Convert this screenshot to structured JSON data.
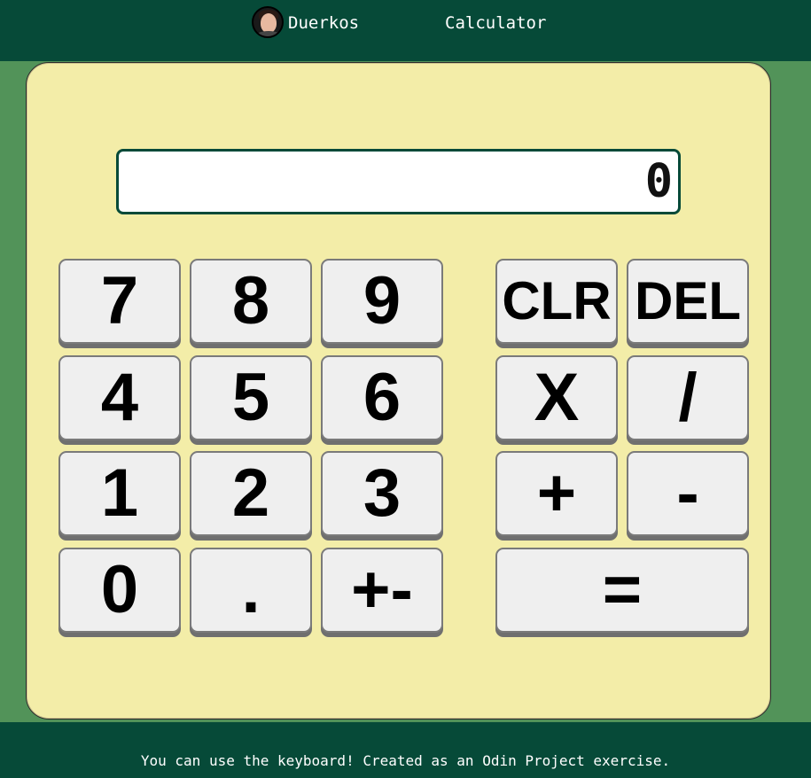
{
  "header": {
    "author_name": "Duerkos",
    "title": "Calculator"
  },
  "display": {
    "value": "0"
  },
  "keys": {
    "k7": "7",
    "k8": "8",
    "k9": "9",
    "k4": "4",
    "k5": "5",
    "k6": "6",
    "k1": "1",
    "k2": "2",
    "k3": "3",
    "k0": "0",
    "decimal": ".",
    "sign": "+-",
    "clear": "CLR",
    "delete": "DEL",
    "multiply": "X",
    "divide": "/",
    "add": "+",
    "subtract": "-",
    "equals": "="
  },
  "footer": {
    "text": "You can use the keyboard! Created as an Odin Project exercise."
  },
  "colors": {
    "header_bg": "#064a38",
    "page_bg": "#529359",
    "calculator_bg": "#f3eda8",
    "key_bg": "#efefef"
  }
}
